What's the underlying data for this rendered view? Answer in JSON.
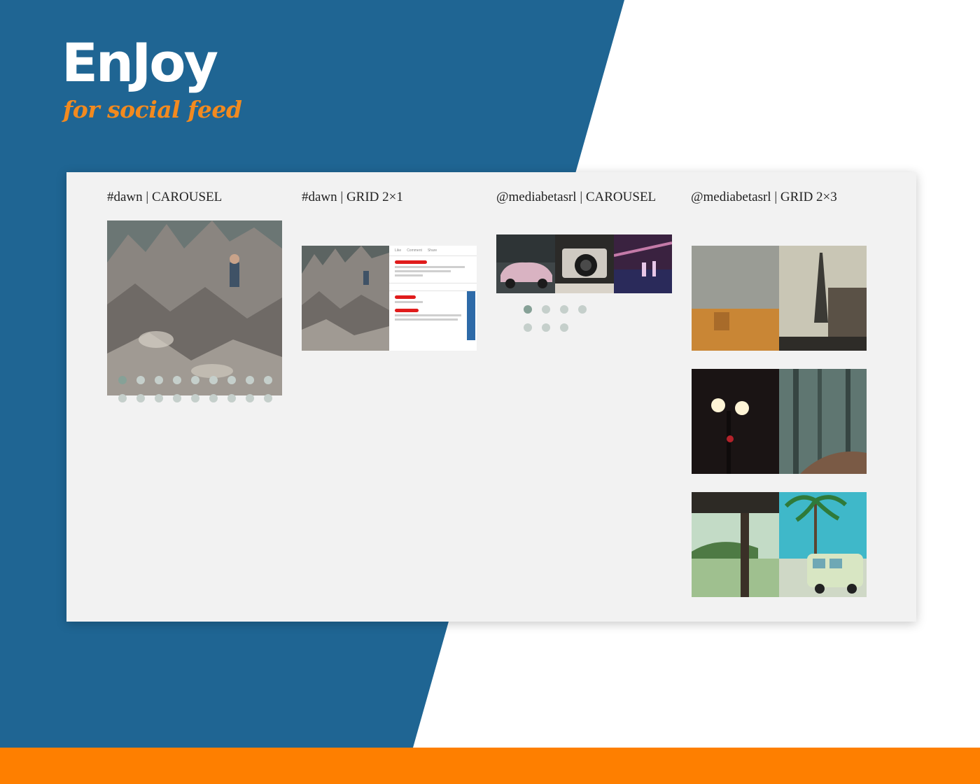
{
  "brand": {
    "title": "EnJoy",
    "subtitle": "for social feed",
    "colors": {
      "blue": "#1f6593",
      "orange": "#fe7f00",
      "panel": "#f2f2f2"
    }
  },
  "widgets": [
    {
      "title": "#dawn | CAROUSEL",
      "dots": 18,
      "active_dot": 1
    },
    {
      "title": "#dawn | GRID 2×1"
    },
    {
      "title": "@mediabetasrl | CAROUSEL",
      "dots": 7,
      "active_dot": 1
    },
    {
      "title": "@mediabetasrl | GRID 2×3"
    }
  ],
  "post_preview": {
    "actions": [
      "Like",
      "Comment",
      "Share"
    ]
  }
}
